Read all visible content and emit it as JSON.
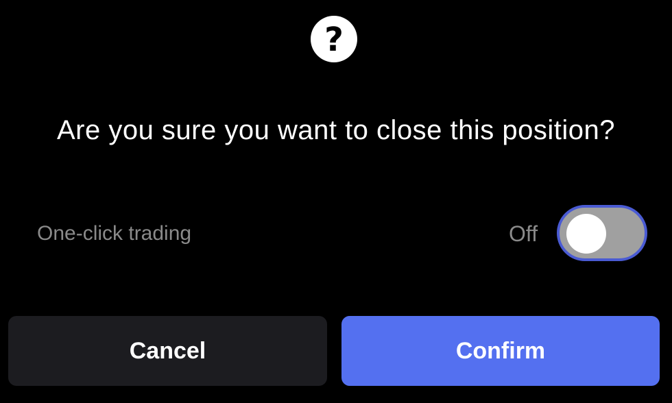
{
  "dialog": {
    "icon": "question-icon",
    "icon_glyph": "?",
    "title": "Are you sure you want to close this position?",
    "one_click_trading": {
      "label": "One-click trading",
      "state_label": "Off",
      "enabled": false
    },
    "buttons": {
      "cancel_label": "Cancel",
      "confirm_label": "Confirm"
    }
  },
  "colors": {
    "background": "#000000",
    "primary_button": "#5470f0",
    "secondary_button": "#1c1c20",
    "toggle_track_off": "#a0a0a0",
    "toggle_focus_ring": "#4a5bd3",
    "muted_text": "#8a8a8a"
  }
}
